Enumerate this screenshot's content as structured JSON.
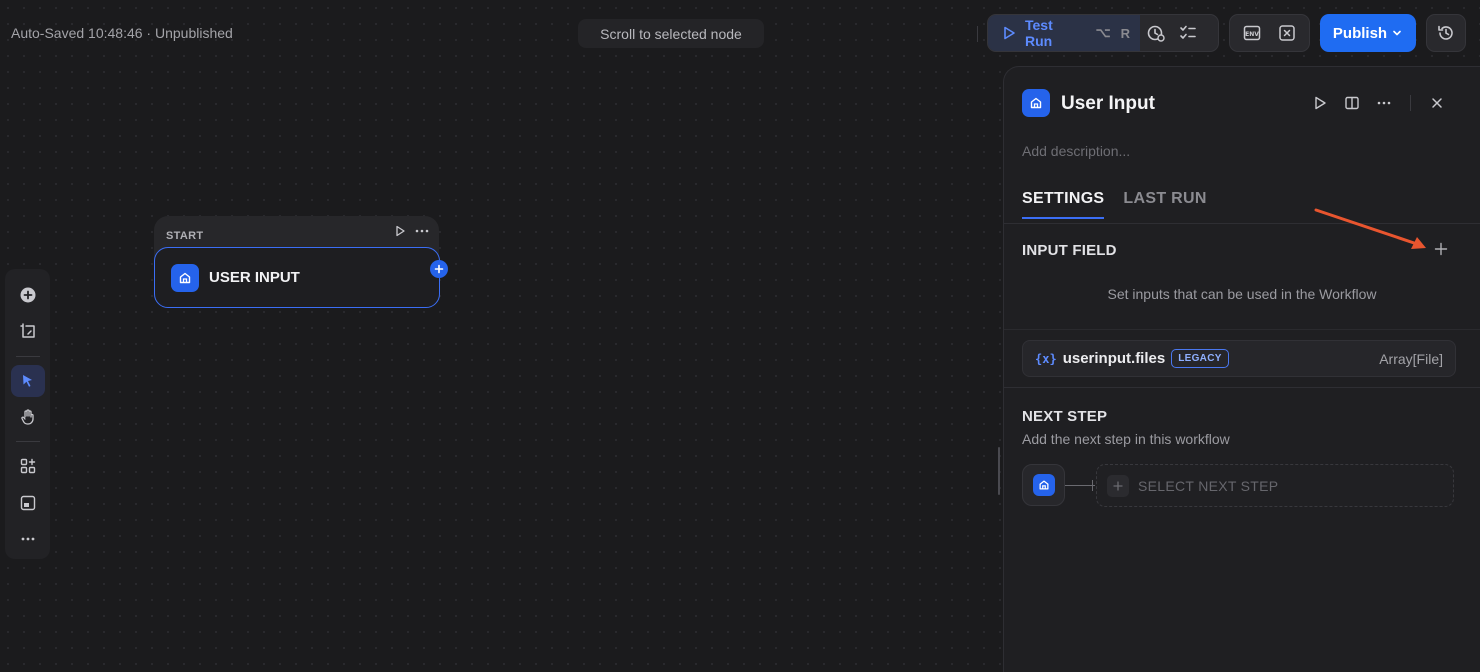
{
  "topbar": {
    "autosave_text": "Auto-Saved 10:48:46 · Unpublished",
    "scroll_button": "Scroll to selected node",
    "test_run_label": "Test Run",
    "shortcut_keys": [
      "⌥",
      "R"
    ],
    "publish_label": "Publish",
    "icons": [
      "play-icon",
      "checklist-clock-icon",
      "variables-icon",
      "env-icon",
      "conversation-var-icon",
      "history-icon"
    ]
  },
  "left_toolbar": {
    "tools": [
      "add-node",
      "add-note",
      "pointer",
      "hand",
      "organize",
      "minimap",
      "more"
    ],
    "active_tool": "pointer"
  },
  "canvas": {
    "node": {
      "header": "START",
      "title": "USER INPUT"
    }
  },
  "panel": {
    "title": "User Input",
    "description_placeholder": "Add description...",
    "tabs": [
      "SETTINGS",
      "LAST RUN"
    ],
    "active_tab": "SETTINGS",
    "input_field_title": "INPUT FIELD",
    "input_field_hint": "Set inputs that can be used in the Workflow",
    "variable": {
      "icon": "{x}",
      "name": "userinput.files",
      "badge": "LEGACY",
      "type": "Array[File]"
    },
    "next_step_title": "NEXT STEP",
    "next_step_desc": "Add the next step in this workflow",
    "select_next_step": "SELECT NEXT STEP"
  },
  "colors": {
    "accent": "#2563eb",
    "annotation_arrow": "#e8552f",
    "background": "#1b1b1d"
  }
}
